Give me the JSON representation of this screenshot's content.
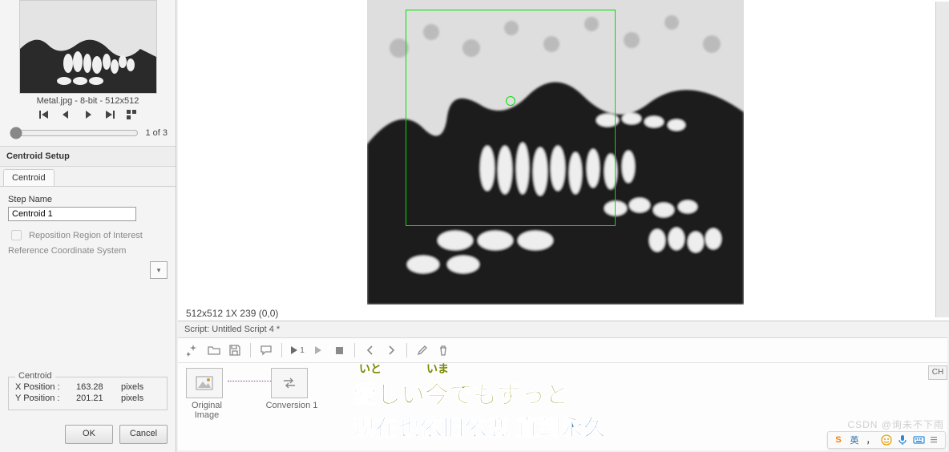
{
  "thumbnail": {
    "label": "Metal.jpg - 8-bit - 512x512"
  },
  "frame": {
    "count_label": "1 of 3"
  },
  "centroid_setup": {
    "title": "Centroid Setup",
    "tab": "Centroid",
    "step_name_label": "Step Name",
    "step_name_value": "Centroid 1",
    "reposition_label": "Reposition Region of Interest",
    "refcoord_label": "Reference Coordinate System"
  },
  "results": {
    "legend": "Centroid",
    "x_label": "X Position :",
    "x_value": "163.28",
    "x_units": "pixels",
    "y_label": "Y Position :",
    "y_value": "201.21",
    "y_units": "pixels"
  },
  "buttons": {
    "ok": "OK",
    "cancel": "Cancel"
  },
  "main": {
    "coord": "512x512 1X 239   (0,0)"
  },
  "script": {
    "title": "Script: Untitled Script 4 *",
    "node1": "Original Image",
    "node2": "Conversion 1",
    "run_label": "1"
  },
  "lyrics": {
    "furi1": "いと",
    "furi2": "いま",
    "line1": "愛しい今でもずっと",
    "line2": "现在也依旧依恋 直到永久"
  },
  "ime": {
    "mode": "英",
    "punct": "，",
    "ch_badge": "CH"
  },
  "watermark": "CSDN @询未不下雨"
}
